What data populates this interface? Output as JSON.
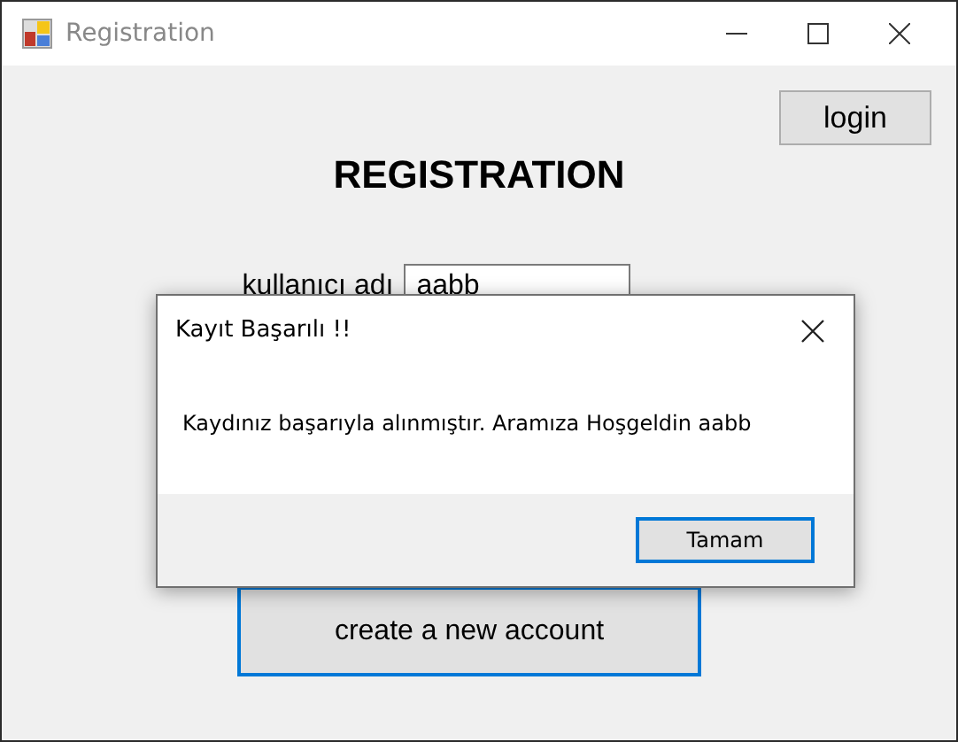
{
  "window": {
    "title": "Registration"
  },
  "login_button": "login",
  "heading": "REGISTRATION",
  "username": {
    "label": "kullanıcı adı",
    "value": "aabb"
  },
  "create_button": "create a new account",
  "dialog": {
    "title": "Kayıt Başarılı !!",
    "message": "Kaydınız başarıyla alınmıştır. Aramıza Hoşgeldin aabb",
    "buttons": [
      {
        "label": "Tamam",
        "focused": true
      }
    ]
  }
}
